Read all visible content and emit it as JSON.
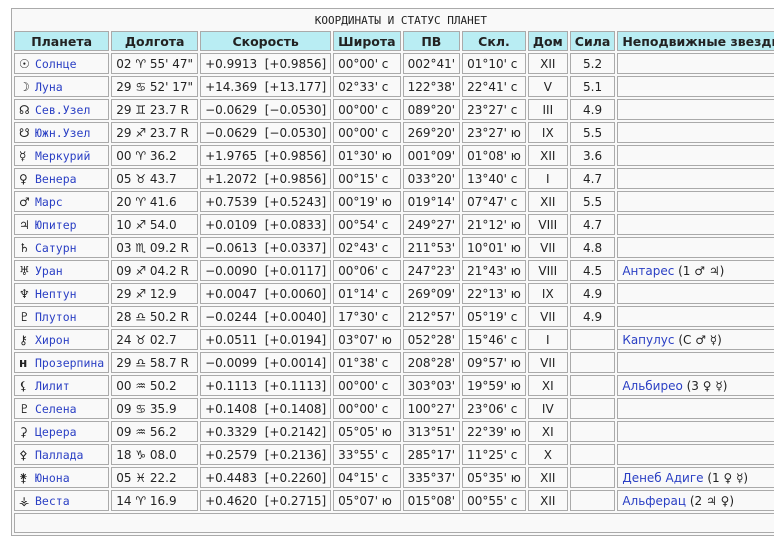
{
  "title": "КООРДИНАТЫ И СТАТУС ПЛАНЕТ",
  "headers": [
    "Планета",
    "Долгота",
    "Скорость",
    "Широта",
    "ПВ",
    "Скл.",
    "Дом",
    "Сила",
    "Неподвижные звезды"
  ],
  "rows": [
    {
      "sym": "☉",
      "name": "Солнце",
      "lon": "02 ♈ 55' 47\"",
      "speed": "+0.9913  [+0.9856]",
      "lat": "00°00' с",
      "pv": "002°41'",
      "decl": "01°10' с",
      "house": "XII",
      "power": "5.2",
      "star": "",
      "star_info": ""
    },
    {
      "sym": "☽",
      "name": "Луна",
      "lon": "29 ♋ 52' 17\"",
      "speed": "+14.369  [+13.177]",
      "lat": "02°33' с",
      "pv": "122°38'",
      "decl": "22°41' с",
      "house": "V",
      "power": "5.1",
      "star": "",
      "star_info": ""
    },
    {
      "sym": "☊",
      "name": "Сев.Узел",
      "lon": "29 ♊ 23.7  R",
      "speed": "−0.0629  [−0.0530]",
      "lat": "00°00' с",
      "pv": "089°20'",
      "decl": "23°27' с",
      "house": "III",
      "power": "4.9",
      "star": "",
      "star_info": ""
    },
    {
      "sym": "☋",
      "name": "Южн.Узел",
      "lon": "29 ♐ 23.7  R",
      "speed": "−0.0629  [−0.0530]",
      "lat": "00°00' с",
      "pv": "269°20'",
      "decl": "23°27' ю",
      "house": "IX",
      "power": "5.5",
      "star": "",
      "star_info": ""
    },
    {
      "sym": "☿",
      "name": "Меркурий",
      "lon": "00 ♈ 36.2",
      "speed": "+1.9765  [+0.9856]",
      "lat": "01°30' ю",
      "pv": "001°09'",
      "decl": "01°08' ю",
      "house": "XII",
      "power": "3.6",
      "star": "",
      "star_info": ""
    },
    {
      "sym": "♀",
      "name": "Венера",
      "lon": "05 ♉ 43.7",
      "speed": "+1.2072  [+0.9856]",
      "lat": "00°15' с",
      "pv": "033°20'",
      "decl": "13°40' с",
      "house": "I",
      "power": "4.7",
      "star": "",
      "star_info": ""
    },
    {
      "sym": "♂",
      "name": "Марс",
      "lon": "20 ♈ 41.6",
      "speed": "+0.7539  [+0.5243]",
      "lat": "00°19' ю",
      "pv": "019°14'",
      "decl": "07°47' с",
      "house": "XII",
      "power": "5.5",
      "star": "",
      "star_info": ""
    },
    {
      "sym": "♃",
      "name": "Юпитер",
      "lon": "10 ♐ 54.0",
      "speed": "+0.0109  [+0.0833]",
      "lat": "00°54' с",
      "pv": "249°27'",
      "decl": "21°12' ю",
      "house": "VIII",
      "power": "4.7",
      "star": "",
      "star_info": ""
    },
    {
      "sym": "♄",
      "name": "Сатурн",
      "lon": "03 ♏ 09.2  R",
      "speed": "−0.0613  [+0.0337]",
      "lat": "02°43' с",
      "pv": "211°53'",
      "decl": "10°01' ю",
      "house": "VII",
      "power": "4.8",
      "star": "",
      "star_info": ""
    },
    {
      "sym": "♅",
      "name": "Уран",
      "lon": "09 ♐ 04.2  R",
      "speed": "−0.0090  [+0.0117]",
      "lat": "00°06' с",
      "pv": "247°23'",
      "decl": "21°43' ю",
      "house": "VIII",
      "power": "4.5",
      "star": "Антарес",
      "star_info": " (1 ♂ ♃)"
    },
    {
      "sym": "♆",
      "name": "Нептун",
      "lon": "29 ♐ 12.9",
      "speed": "+0.0047  [+0.0060]",
      "lat": "01°14' с",
      "pv": "269°09'",
      "decl": "22°13' ю",
      "house": "IX",
      "power": "4.9",
      "star": "",
      "star_info": ""
    },
    {
      "sym": "♇",
      "name": "Плутон",
      "lon": "28 ♎ 50.2  R",
      "speed": "−0.0244  [+0.0040]",
      "lat": "17°30' с",
      "pv": "212°57'",
      "decl": "05°19' с",
      "house": "VII",
      "power": "4.9",
      "star": "",
      "star_info": ""
    },
    {
      "sym": "⚷",
      "name": "Хирон",
      "lon": "24 ♉ 02.7",
      "speed": "+0.0511  [+0.0194]",
      "lat": "03°07' ю",
      "pv": "052°28'",
      "decl": "15°46' с",
      "house": "I",
      "power": "",
      "star": "Капулус",
      "star_info": " (С ♂ ☿)"
    },
    {
      "sym": "н",
      "name": "Прозерпина",
      "lon": "29 ♎ 58.7  R",
      "speed": "−0.0099  [+0.0014]",
      "lat": "01°38' с",
      "pv": "208°28'",
      "decl": "09°57' ю",
      "house": "VII",
      "power": "",
      "star": "",
      "star_info": ""
    },
    {
      "sym": "⚸",
      "name": "Лилит",
      "lon": "00 ♒ 50.2",
      "speed": "+0.1113  [+0.1113]",
      "lat": "00°00' с",
      "pv": "303°03'",
      "decl": "19°59' ю",
      "house": "XI",
      "power": "",
      "star": "Альбирео",
      "star_info": " (3 ♀ ☿)"
    },
    {
      "sym": "♇",
      "name": "Селена",
      "lon": "09 ♋ 35.9",
      "speed": "+0.1408  [+0.1408]",
      "lat": "00°00' с",
      "pv": "100°27'",
      "decl": "23°06' с",
      "house": "IV",
      "power": "",
      "star": "",
      "star_info": ""
    },
    {
      "sym": "⚳",
      "name": "Церера",
      "lon": "09 ♒ 56.2",
      "speed": "+0.3329  [+0.2142]",
      "lat": "05°05' ю",
      "pv": "313°51'",
      "decl": "22°39' ю",
      "house": "XI",
      "power": "",
      "star": "",
      "star_info": ""
    },
    {
      "sym": "⚴",
      "name": "Паллада",
      "lon": "18 ♑ 08.0",
      "speed": "+0.2579  [+0.2136]",
      "lat": "33°55' с",
      "pv": "285°17'",
      "decl": "11°25' с",
      "house": "X",
      "power": "",
      "star": "",
      "star_info": ""
    },
    {
      "sym": "⚵",
      "name": "Юнона",
      "lon": "05 ♓ 22.2",
      "speed": "+0.4483  [+0.2260]",
      "lat": "04°15' с",
      "pv": "335°37'",
      "decl": "05°35' ю",
      "house": "XII",
      "power": "",
      "star": "Денеб Адиге",
      "star_info": " (1 ♀ ☿)"
    },
    {
      "sym": "⚶",
      "name": "Веста",
      "lon": "14 ♈ 16.9",
      "speed": "+0.4620  [+0.2715]",
      "lat": "05°07' ю",
      "pv": "015°08'",
      "decl": "00°55' с",
      "house": "XII",
      "power": "",
      "star": "Альферац",
      "star_info": " (2 ♃ ♀)"
    }
  ]
}
